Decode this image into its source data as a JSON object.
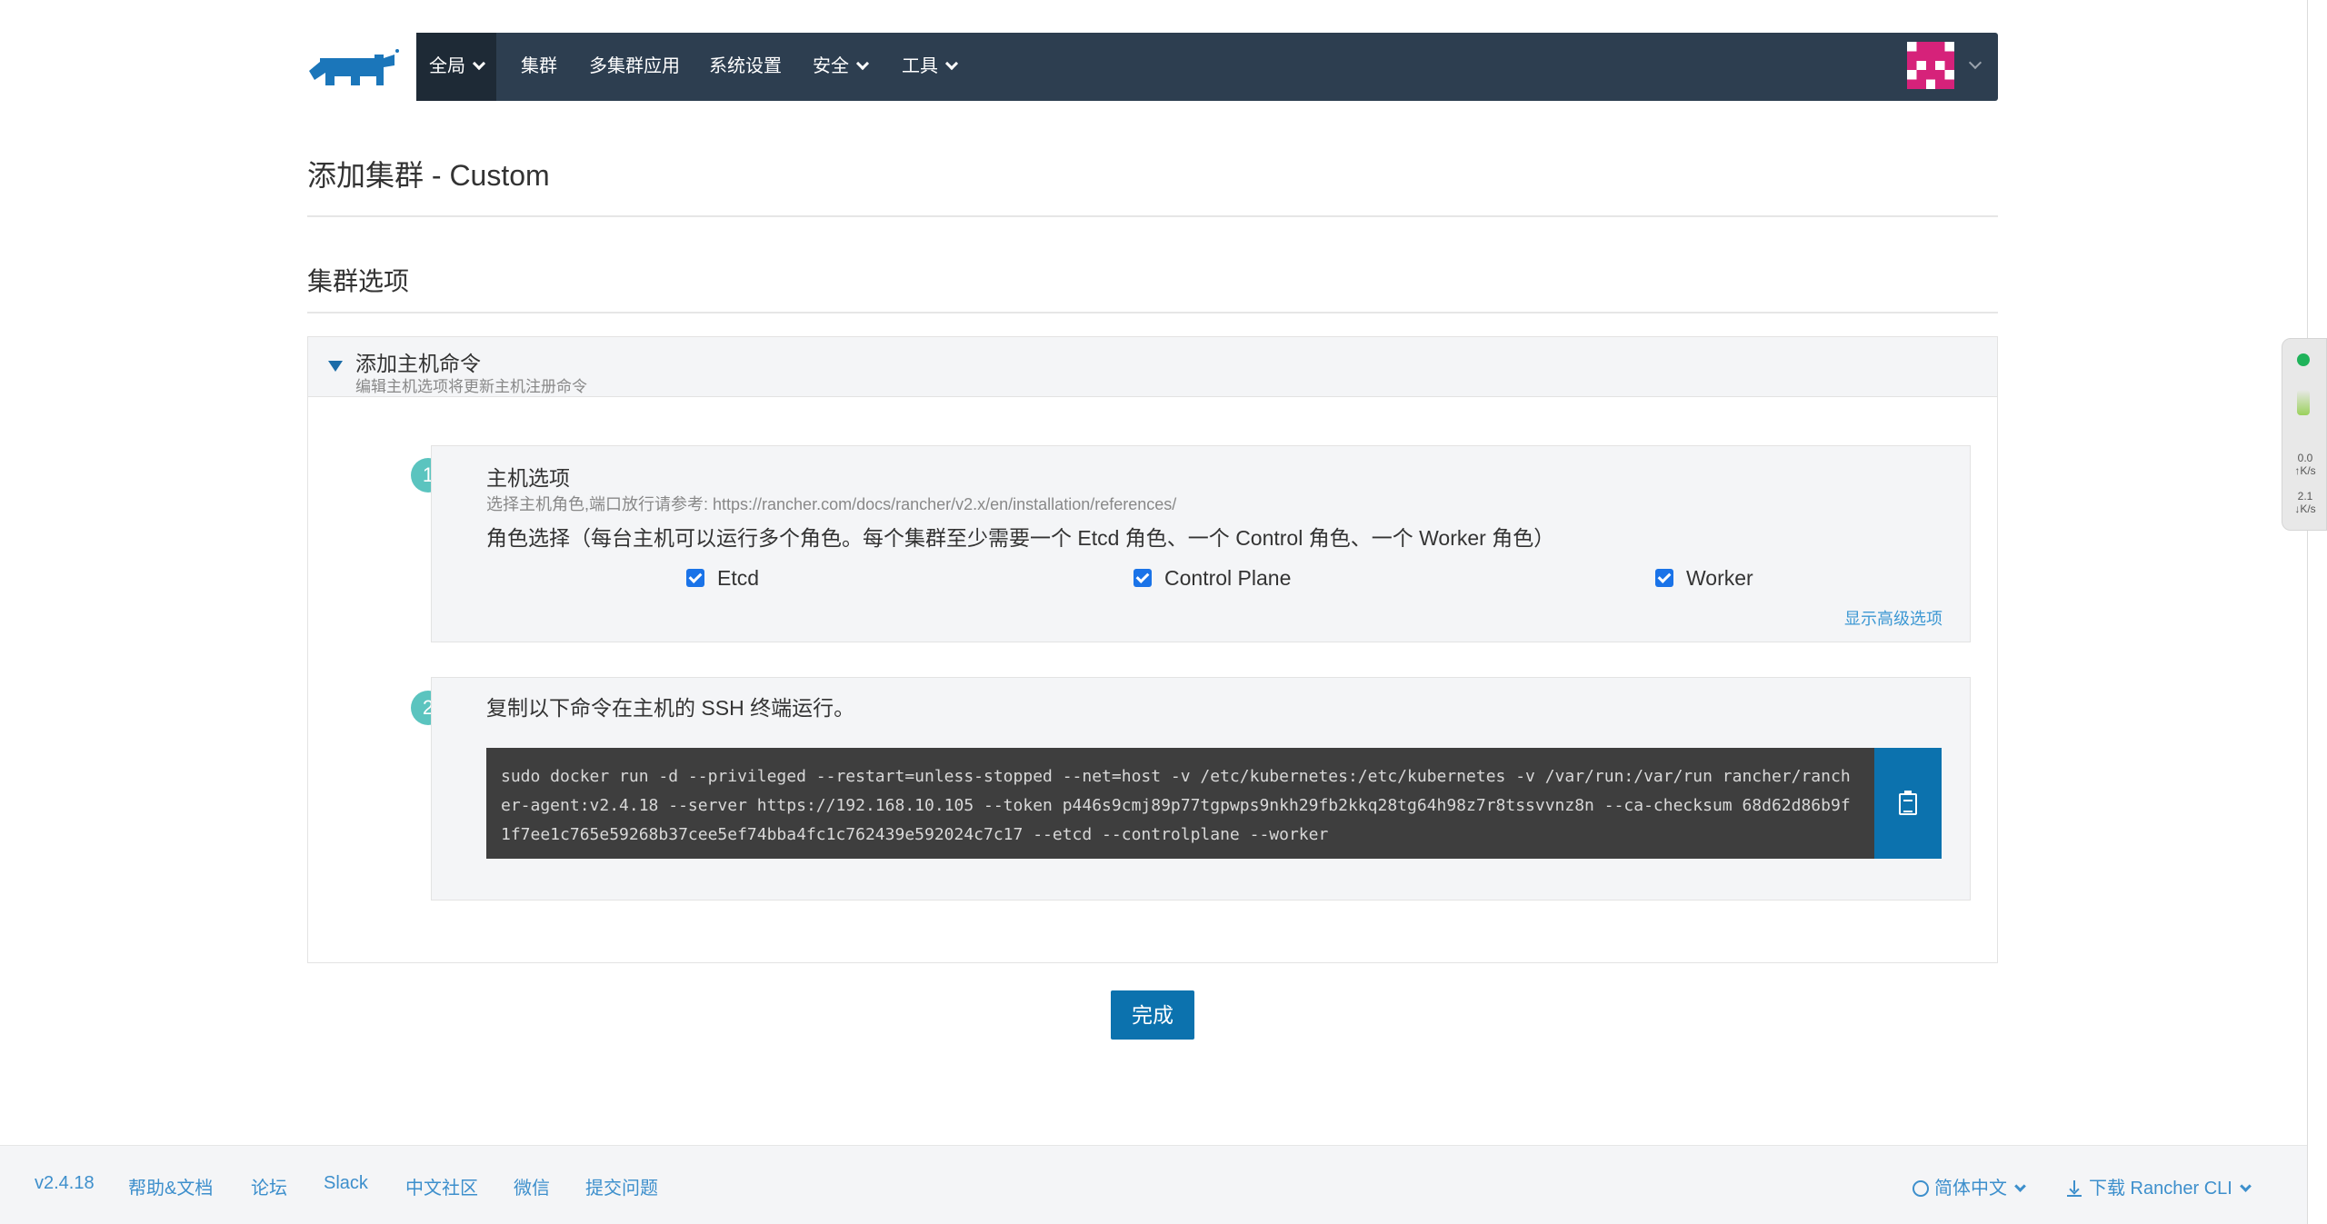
{
  "nav": {
    "items": [
      "全局",
      "集群",
      "多集群应用",
      "系统设置",
      "安全",
      "工具"
    ]
  },
  "page": {
    "title": "添加集群 - Custom",
    "section_title": "集群选项"
  },
  "accordion": {
    "title": "添加主机命令",
    "subtitle": "编辑主机选项将更新主机注册命令"
  },
  "step1": {
    "number": "1",
    "title": "主机选项",
    "subtitle": "选择主机角色,端口放行请参考: https://rancher.com/docs/rancher/v2.x/en/installation/references/",
    "role_text": "角色选择（每台主机可以运行多个角色。每个集群至少需要一个 Etcd 角色、一个 Control 角色、一个 Worker 角色）",
    "roles": [
      {
        "label": "Etcd",
        "checked": true
      },
      {
        "label": "Control Plane",
        "checked": true
      },
      {
        "label": "Worker",
        "checked": true
      }
    ],
    "advanced_link": "显示高级选项"
  },
  "step2": {
    "number": "2",
    "title": "复制以下命令在主机的 SSH 终端运行。",
    "command": "sudo docker run -d --privileged --restart=unless-stopped --net=host -v /etc/kubernetes:/etc/kubernetes -v /var/run:/var/run rancher/rancher-agent:v2.4.18 --server https://192.168.10.105 --token p446s9cmj89p77tgpwps9nkh29fb2kkq28tg64h98z7r8tssvvnz8n --ca-checksum 68d62d86b9f1f7ee1c765e59268b37cee5ef74bba4fc1c762439e592024c7c17 --etcd --controlplane --worker"
  },
  "done_label": "完成",
  "footer": {
    "version": "v2.4.18",
    "links": [
      "帮助&文档",
      "论坛",
      "Slack",
      "中文社区",
      "微信",
      "提交问题"
    ],
    "language": "简体中文",
    "download": "下载 Rancher CLI"
  },
  "widget": {
    "upload": "0.0",
    "download": "2.1",
    "unit": "K/s"
  },
  "colors": {
    "nav_bg": "#2d3e50",
    "accent": "#0c72ae",
    "step_badge": "#5bc4bf"
  }
}
